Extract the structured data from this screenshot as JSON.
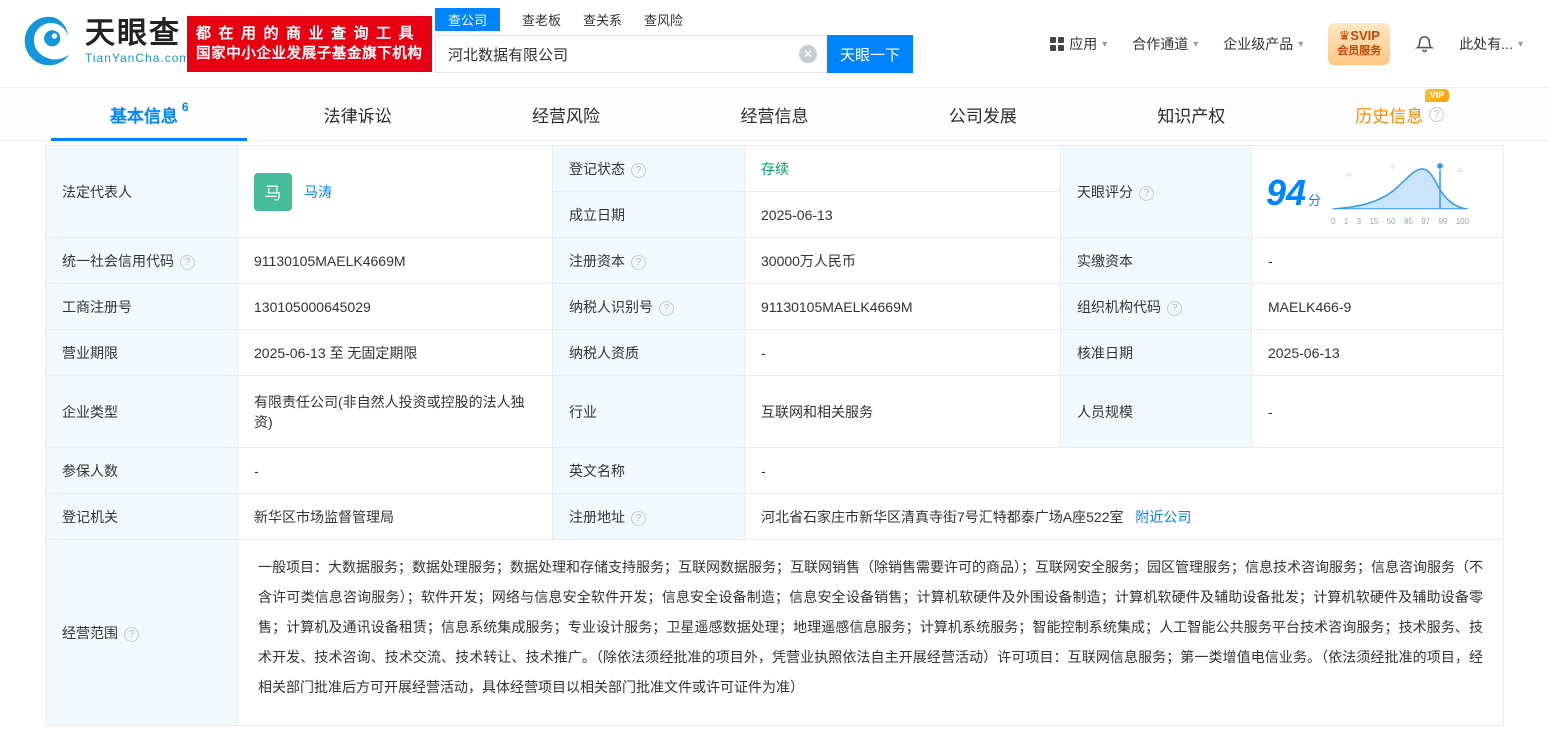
{
  "colors": {
    "accent_blue": "#0084ff",
    "brand_red": "#e60012",
    "status_green": "#00a65a",
    "vip_orange": "#ff8a00",
    "label_bg": "#f2f9fc",
    "avatar_green": "#45bd9a"
  },
  "header": {
    "logo": {
      "title": "天眼查",
      "subtitle": "TianYanCha.com"
    },
    "banner": {
      "line1": "都在用的商业查询工具",
      "line2": "国家中小企业发展子基金旗下机构"
    },
    "search": {
      "tabs": [
        {
          "label": "查公司"
        },
        {
          "label": "查老板"
        },
        {
          "label": "查关系"
        },
        {
          "label": "查风险"
        }
      ],
      "value": "河北数据有限公司",
      "button": "天眼一下"
    },
    "nav": [
      {
        "label": "应用"
      },
      {
        "label": "合作通道"
      },
      {
        "label": "企业级产品"
      }
    ],
    "svip": {
      "line1": "SVIP",
      "line2": "会员服务"
    },
    "more": "此处有..."
  },
  "tabs": [
    {
      "label": "基本信息",
      "count": "6"
    },
    {
      "label": "法律诉讼"
    },
    {
      "label": "经营风险"
    },
    {
      "label": "经营信息"
    },
    {
      "label": "公司发展"
    },
    {
      "label": "知识产权"
    },
    {
      "label": "历史信息",
      "badge": "VIP"
    }
  ],
  "fields": {
    "legal_rep": {
      "label": "法定代表人",
      "avatar": "马",
      "name": "马涛"
    },
    "reg_status": {
      "label": "登记状态",
      "value": "存续"
    },
    "establish_date": {
      "label": "成立日期",
      "value": "2025-06-13"
    },
    "score": {
      "label": "天眼评分"
    },
    "credit_code": {
      "label": "统一社会信用代码",
      "value": "91130105MAELK4669M"
    },
    "reg_capital": {
      "label": "注册资本",
      "value": "30000万人民币"
    },
    "paid_capital": {
      "label": "实缴资本",
      "value": "-"
    },
    "reg_number": {
      "label": "工商注册号",
      "value": "130105000645029"
    },
    "taxpayer_id": {
      "label": "纳税人识别号",
      "value": "91130105MAELK4669M"
    },
    "org_code": {
      "label": "组织机构代码",
      "value": "MAELK466-9"
    },
    "business_term": {
      "label": "营业期限",
      "value": "2025-06-13 至 无固定期限"
    },
    "taxpayer_quality": {
      "label": "纳税人资质",
      "value": "-"
    },
    "approval_date": {
      "label": "核准日期",
      "value": "2025-06-13"
    },
    "company_type": {
      "label": "企业类型",
      "value": "有限责任公司(非自然人投资或控股的法人独资)"
    },
    "industry": {
      "label": "行业",
      "value": "互联网和相关服务"
    },
    "staff_size": {
      "label": "人员规模",
      "value": "-"
    },
    "insured_count": {
      "label": "参保人数",
      "value": "-"
    },
    "english_name": {
      "label": "英文名称",
      "value": "-"
    },
    "reg_authority": {
      "label": "登记机关",
      "value": "新华区市场监督管理局"
    },
    "reg_address": {
      "label": "注册地址",
      "value": "河北省石家庄市新华区清真寺街7号汇特都泰广场A座522室",
      "link": "附近公司"
    },
    "business_scope": {
      "label": "经营范围",
      "value": "一般项目：大数据服务；数据处理服务；数据处理和存储支持服务；互联网数据服务；互联网销售（除销售需要许可的商品）；互联网安全服务；园区管理服务；信息技术咨询服务；信息咨询服务（不含许可类信息咨询服务）；软件开发；网络与信息安全软件开发；信息安全设备制造；信息安全设备销售；计算机软硬件及外围设备制造；计算机软硬件及辅助设备批发；计算机软硬件及辅助设备零售；计算机及通讯设备租赁；信息系统集成服务；专业设计服务；卫星遥感数据处理；地理遥感信息服务；计算机系统服务；智能控制系统集成；人工智能公共服务平台技术咨询服务；技术服务、技术开发、技术咨询、技术交流、技术转让、技术推广。（除依法须经批准的项目外，凭营业执照依法自主开展经营活动）许可项目：互联网信息服务；第一类增值电信业务。（依法须经批准的项目，经相关部门批准后方可开展经营活动，具体经营项目以相关部门批准文件或许可证件为准）"
    }
  },
  "score_chart": {
    "type": "area",
    "score": "94",
    "unit": "分",
    "axis_ticks": [
      "0",
      "1",
      "3",
      "15",
      "50",
      "85",
      "97",
      "99",
      "100"
    ]
  }
}
